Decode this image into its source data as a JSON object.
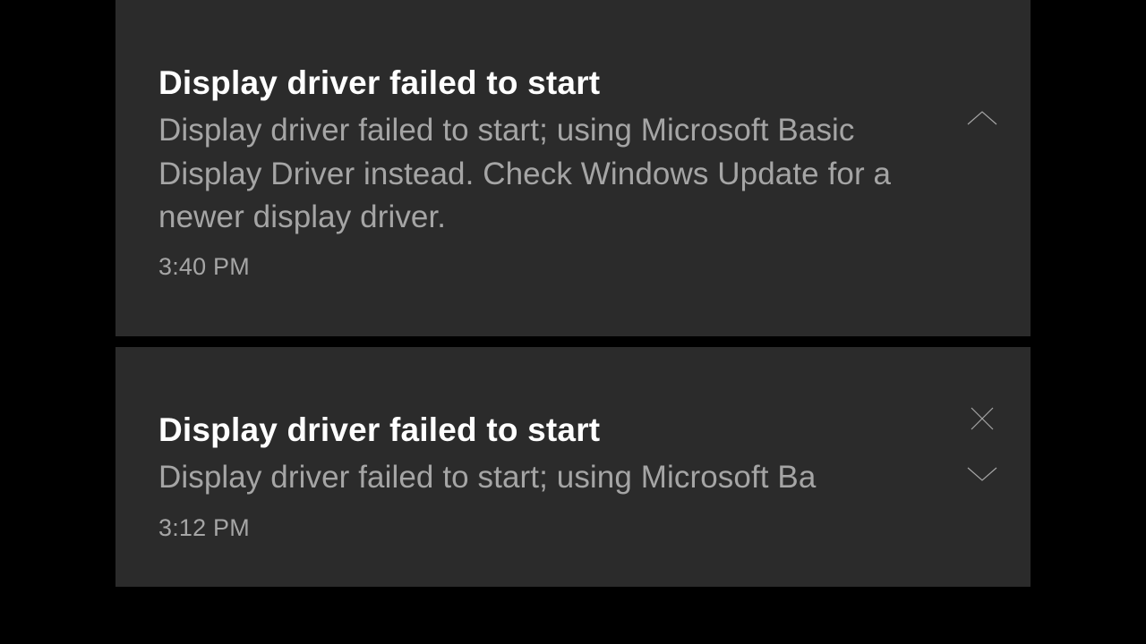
{
  "notifications": [
    {
      "title": "Display driver failed to start",
      "body": "Display driver failed to start; using Microsoft Basic Display Driver instead. Check Windows Update for a newer display driver.",
      "time": "3:40 PM"
    },
    {
      "title": "Display driver failed to start",
      "body": "Display driver failed to start; using Microsoft Ba",
      "time": "3:12 PM"
    }
  ]
}
